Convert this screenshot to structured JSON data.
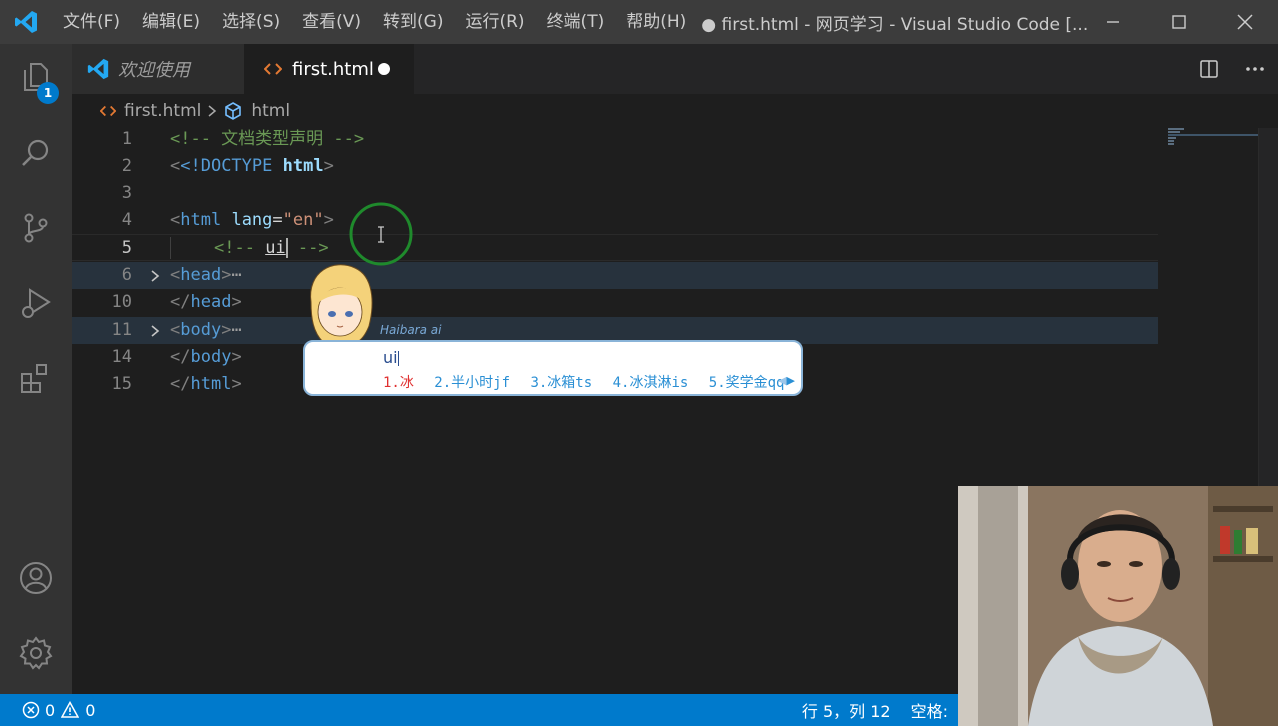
{
  "titlebar": {
    "menu": [
      "文件(F)",
      "编辑(E)",
      "选择(S)",
      "查看(V)",
      "转到(G)",
      "运行(R)",
      "终端(T)",
      "帮助(H)"
    ],
    "window_title": "● first.html - 网页学习 - Visual Studio Code [..."
  },
  "activitybar": {
    "explorer_badge": "1"
  },
  "tabs": {
    "welcome_label": "欢迎使用",
    "active_label": "first.html"
  },
  "breadcrumb": {
    "file": "first.html",
    "symbol": "html"
  },
  "editor": {
    "lines": [
      {
        "number": "1"
      },
      {
        "number": "2"
      },
      {
        "number": "3"
      },
      {
        "number": "4"
      },
      {
        "number": "5"
      },
      {
        "number": "6"
      },
      {
        "number": "10"
      },
      {
        "number": "11"
      },
      {
        "number": "14"
      },
      {
        "number": "15"
      }
    ],
    "code": {
      "l1_comment": "<!-- 文档类型声明 -->",
      "l2_doctype": "<!DOCTYPE",
      "l2_html": "html",
      "l4_tag": "html",
      "l4_attr": "lang",
      "l4_value": "\"en\"",
      "l5_open": "<!-- ",
      "l5_text": "ui",
      "l5_close": " -->",
      "l6_tag": "head",
      "l10_tag": "head",
      "l11_tag": "body",
      "l14_tag": "body",
      "l15_tag": "html",
      "ellipsis": "⋯"
    }
  },
  "ime": {
    "skin_name": "Haibara ai",
    "input": "ui",
    "candidates": [
      "1.冰",
      "2.半小时jf",
      "3.冰箱ts",
      "4.冰淇淋is",
      "5.奖学金qq"
    ]
  },
  "statusbar": {
    "errors": "0",
    "warnings": "0",
    "position": "行 5，列 12",
    "spaces": "空格:"
  },
  "colors": {
    "accent": "#007acc",
    "titlebar_bg": "#3c3c3c",
    "editor_bg": "#1e1e1e",
    "comment": "#6a9955",
    "tag": "#569cd6"
  }
}
